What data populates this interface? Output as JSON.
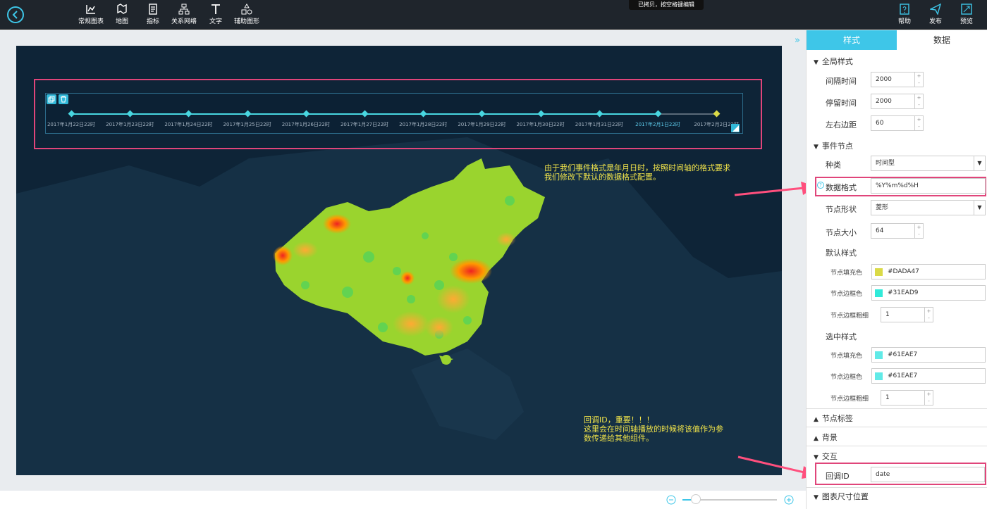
{
  "toolbar": {
    "tools": [
      {
        "label": "常规图表",
        "icon": "chart-icon"
      },
      {
        "label": "地图",
        "icon": "map-icon"
      },
      {
        "label": "指标",
        "icon": "indicator-icon"
      },
      {
        "label": "关系网络",
        "icon": "network-icon"
      },
      {
        "label": "文字",
        "icon": "text-icon"
      },
      {
        "label": "辅助图形",
        "icon": "shape-icon"
      }
    ],
    "right": [
      {
        "label": "帮助",
        "icon": "help-icon"
      },
      {
        "label": "发布",
        "icon": "publish-icon"
      },
      {
        "label": "预览",
        "icon": "preview-icon"
      }
    ],
    "toast": "已拷贝，按空格键编辑"
  },
  "timeline": {
    "labels": [
      "2017年1月22日22时",
      "2017年1月23日22时",
      "2017年1月24日22时",
      "2017年1月25日22时",
      "2017年1月26日22时",
      "2017年1月27日22时",
      "2017年1月28日22时",
      "2017年1月29日22时",
      "2017年1月30日22时",
      "2017年1月31日22时",
      "2017年2月1日22时",
      "2017年2月2日22时"
    ],
    "active_index": 10
  },
  "annotations": {
    "top_line1": "由于我们事件格式是年月日时，按照时间轴的格式要求",
    "top_line2": "我们修改下默认的数据格式配置。",
    "bottom_line1": "回调ID，重要！！！",
    "bottom_line2": "这里会在时间轴播放的时候将该值作为参",
    "bottom_line3": "数传递给其他组件。"
  },
  "panel": {
    "tab_style": "样式",
    "tab_data": "数据",
    "global_section": "全局样式",
    "interval_label": "间隔时间",
    "interval_value": "2000",
    "stay_label": "停留时间",
    "stay_value": "2000",
    "margin_label": "左右边距",
    "margin_value": "60",
    "event_section": "事件节点",
    "type_label": "种类",
    "type_value": "时间型",
    "format_label": "数据格式",
    "format_value": "%Y%m%d%H",
    "shape_label": "节点形状",
    "shape_value": "菱形",
    "size_label": "节点大小",
    "size_value": "64",
    "default_style": "默认样式",
    "fill_label": "节点填充色",
    "fill_value": "#DADA47",
    "fill_color": "#DADA47",
    "border_label": "节点边框色",
    "border_value": "#31EAD9",
    "border_color": "#31EAD9",
    "border_width_label": "节点边框粗细",
    "border_width_value": "1",
    "selected_style": "选中样式",
    "sel_fill_label": "节点填充色",
    "sel_fill_value": "#61EAE7",
    "sel_fill_color": "#61EAE7",
    "sel_border_label": "节点边框色",
    "sel_border_value": "#61EAE7",
    "sel_border_color": "#61EAE7",
    "sel_border_width_label": "节点边框粗细",
    "sel_border_width_value": "1",
    "node_label_section": "节点标签",
    "background_section": "背景",
    "interaction_section": "交互",
    "callback_label": "回调ID",
    "callback_value": "date",
    "size_pos_section": "图表尺寸位置"
  }
}
